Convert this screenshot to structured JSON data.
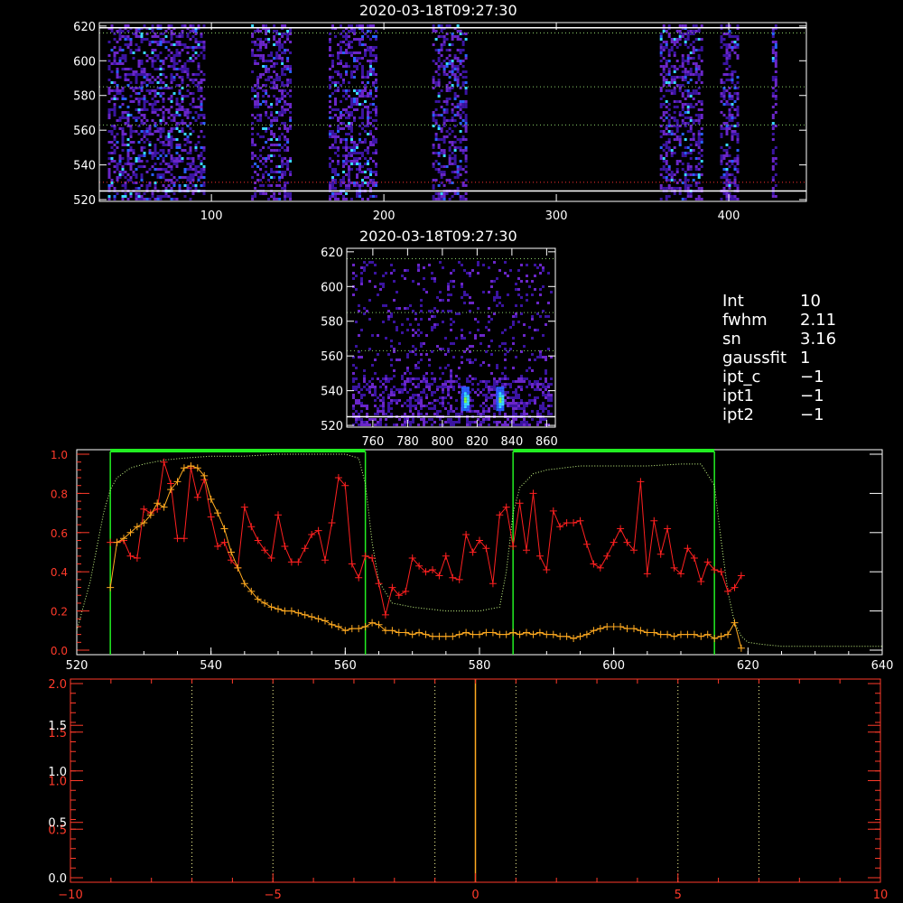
{
  "panels": {
    "top_title": "2020-03-18T09:27:30",
    "mid_title": "2020-03-18T09:27:30"
  },
  "info": [
    {
      "key": "Int",
      "value": "10"
    },
    {
      "key": "fwhm",
      "value": "2.11"
    },
    {
      "key": "sn",
      "value": "3.16"
    },
    {
      "key": "gaussfit",
      "value": "1"
    },
    {
      "key": "ipt_c",
      "value": "−1"
    },
    {
      "key": "ipt1",
      "value": "−1"
    },
    {
      "key": "ipt2",
      "value": "−1"
    }
  ],
  "colors": {
    "frame": "#ffffff",
    "spectrum": "#ff2020",
    "model": "#ffaa20",
    "reference": "#ccff88",
    "window": "#22ee22",
    "bottom_axis": "#ff3a2a",
    "bottom_grid": "#ffff99",
    "zero_line": "#ffaa20",
    "heat": [
      "#3a14a0",
      "#6a26c8",
      "#2860ff",
      "#38d8ff",
      "#80ff40"
    ]
  },
  "chart_data": [
    {
      "type": "heatmap",
      "title": "2020-03-18T09:27:30",
      "xlim": [
        35,
        445
      ],
      "ylim": [
        519,
        622
      ],
      "x_ticks": [
        100,
        200,
        300,
        400
      ],
      "y_ticks": [
        520,
        540,
        560,
        580,
        600,
        620
      ],
      "y_gridlines": [
        616,
        585,
        563
      ],
      "red_line_y": 530,
      "white_lines_y": [
        525,
        619
      ],
      "bands_x": [
        [
          40,
          95
        ],
        [
          123,
          146
        ],
        [
          168,
          195
        ],
        [
          228,
          248
        ],
        [
          360,
          385
        ],
        [
          395,
          405
        ],
        [
          425,
          428
        ]
      ]
    },
    {
      "type": "heatmap",
      "title": "2020-03-18T09:27:30",
      "xlim": [
        745,
        865
      ],
      "ylim": [
        519,
        622
      ],
      "x_ticks": [
        760,
        780,
        800,
        820,
        840,
        860
      ],
      "y_ticks": [
        520,
        540,
        560,
        580,
        600,
        620
      ],
      "y_gridlines": [
        616,
        585,
        563
      ],
      "white_lines_y": [
        525
      ],
      "hot_spots": [
        [
          813,
          535
        ],
        [
          833,
          535
        ]
      ]
    },
    {
      "type": "line",
      "xlim": [
        520,
        640
      ],
      "ylim": [
        0,
        1.0
      ],
      "x_ticks": [
        520,
        540,
        560,
        580,
        600,
        620,
        640
      ],
      "y_ticks": [
        0.0,
        0.2,
        0.4,
        0.6,
        0.8,
        1.0
      ],
      "x_tick_labels": [
        "520",
        "540",
        "560",
        "580",
        "600",
        "620",
        "640"
      ],
      "y_tick_labels": [
        "0.0",
        "0.2",
        "0.4",
        "0.6",
        "0.8",
        "1.0"
      ],
      "windows": [
        [
          525,
          563
        ],
        [
          585,
          615
        ]
      ],
      "series": [
        {
          "key": "spectrum",
          "x": [
            525,
            526,
            527,
            528,
            529,
            530,
            531,
            532,
            533,
            534,
            535,
            536,
            537,
            538,
            539,
            540,
            541,
            542,
            543,
            544,
            545,
            546,
            547,
            548,
            549,
            550,
            551,
            552,
            553,
            554,
            555,
            556,
            557,
            558,
            559,
            560,
            561,
            562,
            563,
            564,
            565,
            566,
            567,
            568,
            569,
            570,
            571,
            572,
            573,
            574,
            575,
            576,
            577,
            578,
            579,
            580,
            581,
            582,
            583,
            584,
            585,
            586,
            587,
            588,
            589,
            590,
            591,
            592,
            593,
            594,
            595,
            596,
            597,
            598,
            599,
            600,
            601,
            602,
            603,
            604,
            605,
            606,
            607,
            608,
            609,
            610,
            611,
            612,
            613,
            614,
            615,
            616,
            617,
            618,
            619
          ],
          "y": [
            0.55,
            0.55,
            0.56,
            0.48,
            0.47,
            0.72,
            0.7,
            0.72,
            0.96,
            0.85,
            0.57,
            0.57,
            0.93,
            0.78,
            0.87,
            0.68,
            0.53,
            0.55,
            0.46,
            0.42,
            0.73,
            0.63,
            0.56,
            0.51,
            0.47,
            0.69,
            0.53,
            0.45,
            0.45,
            0.52,
            0.59,
            0.61,
            0.46,
            0.65,
            0.88,
            0.84,
            0.44,
            0.37,
            0.48,
            0.47,
            0.34,
            0.18,
            0.32,
            0.28,
            0.3,
            0.47,
            0.43,
            0.4,
            0.41,
            0.38,
            0.48,
            0.37,
            0.36,
            0.59,
            0.5,
            0.56,
            0.52,
            0.34,
            0.69,
            0.73,
            0.53,
            0.75,
            0.51,
            0.8,
            0.48,
            0.41,
            0.71,
            0.63,
            0.65,
            0.65,
            0.66,
            0.54,
            0.44,
            0.42,
            0.48,
            0.55,
            0.62,
            0.55,
            0.51,
            0.86,
            0.39,
            0.66,
            0.49,
            0.62,
            0.42,
            0.39,
            0.52,
            0.47,
            0.35,
            0.45,
            0.41,
            0.4,
            0.3,
            0.32,
            0.38
          ]
        },
        {
          "key": "model",
          "x": [
            525,
            526,
            527,
            528,
            529,
            530,
            531,
            532,
            533,
            534,
            535,
            536,
            537,
            538,
            539,
            540,
            541,
            542,
            543,
            544,
            545,
            546,
            547,
            548,
            549,
            550,
            551,
            552,
            553,
            554,
            555,
            556,
            557,
            558,
            559,
            560,
            561,
            562,
            563,
            564,
            565,
            566,
            567,
            568,
            569,
            570,
            571,
            572,
            573,
            574,
            575,
            576,
            577,
            578,
            579,
            580,
            581,
            582,
            583,
            584,
            585,
            586,
            587,
            588,
            589,
            590,
            591,
            592,
            593,
            594,
            595,
            596,
            597,
            598,
            599,
            600,
            601,
            602,
            603,
            604,
            605,
            606,
            607,
            608,
            609,
            610,
            611,
            612,
            613,
            614,
            615,
            616,
            617,
            618,
            619
          ],
          "y": [
            0.32,
            0.55,
            0.57,
            0.6,
            0.63,
            0.65,
            0.69,
            0.75,
            0.73,
            0.82,
            0.86,
            0.93,
            0.94,
            0.93,
            0.89,
            0.77,
            0.7,
            0.62,
            0.5,
            0.42,
            0.34,
            0.3,
            0.26,
            0.24,
            0.22,
            0.21,
            0.2,
            0.2,
            0.19,
            0.18,
            0.17,
            0.16,
            0.15,
            0.13,
            0.12,
            0.1,
            0.11,
            0.11,
            0.12,
            0.14,
            0.13,
            0.1,
            0.1,
            0.09,
            0.09,
            0.08,
            0.09,
            0.08,
            0.07,
            0.07,
            0.07,
            0.07,
            0.08,
            0.09,
            0.08,
            0.08,
            0.09,
            0.09,
            0.08,
            0.08,
            0.09,
            0.08,
            0.09,
            0.08,
            0.09,
            0.08,
            0.08,
            0.07,
            0.07,
            0.06,
            0.07,
            0.08,
            0.1,
            0.11,
            0.12,
            0.12,
            0.12,
            0.11,
            0.11,
            0.1,
            0.09,
            0.09,
            0.08,
            0.08,
            0.07,
            0.08,
            0.08,
            0.08,
            0.07,
            0.08,
            0.06,
            0.07,
            0.08,
            0.14,
            0.01
          ]
        },
        {
          "key": "reference",
          "x": [
            520,
            522,
            524,
            525,
            526,
            528,
            530,
            533,
            536,
            540,
            545,
            550,
            555,
            560,
            562,
            563,
            564,
            565,
            567,
            570,
            575,
            580,
            583,
            584,
            585,
            586,
            588,
            590,
            595,
            600,
            605,
            610,
            613,
            615,
            616,
            617,
            618,
            619,
            620,
            622,
            625,
            630,
            635,
            640
          ],
          "y": [
            0.1,
            0.35,
            0.7,
            0.82,
            0.88,
            0.93,
            0.95,
            0.97,
            0.98,
            0.99,
            0.99,
            1.0,
            1.0,
            1.0,
            0.98,
            0.85,
            0.55,
            0.35,
            0.24,
            0.22,
            0.2,
            0.2,
            0.22,
            0.4,
            0.7,
            0.83,
            0.9,
            0.92,
            0.94,
            0.94,
            0.94,
            0.95,
            0.95,
            0.84,
            0.56,
            0.3,
            0.14,
            0.07,
            0.04,
            0.03,
            0.02,
            0.02,
            0.02,
            0.02
          ]
        }
      ]
    },
    {
      "type": "line",
      "xlim": [
        -10,
        10
      ],
      "ylim": [
        0,
        2.0
      ],
      "x_ticks": [
        -10,
        -5,
        0,
        5,
        10
      ],
      "x_tick_labels": [
        "−10",
        "−5",
        "0",
        "5",
        "10"
      ],
      "y_tick_labels": [
        "0.0",
        "0.5",
        "0.5",
        "1.0",
        "1.0",
        "1.5",
        "1.5",
        "2.0"
      ],
      "y_tick_positions": [
        0.0,
        0.5,
        0.57,
        1.0,
        1.1,
        1.5,
        1.57,
        2.0
      ],
      "vertical_gridlines": [
        -7,
        -5,
        -1,
        1,
        5,
        7
      ],
      "zero_line": 0,
      "series": []
    }
  ]
}
